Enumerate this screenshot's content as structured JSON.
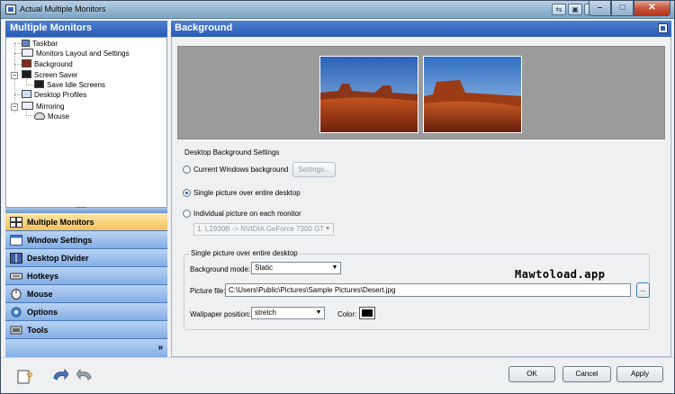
{
  "window": {
    "title": "Actual Multiple Monitors"
  },
  "left_panel": {
    "header": "Multiple Monitors",
    "tree": [
      {
        "label": "Taskbar"
      },
      {
        "label": "Monitors Layout and Settings"
      },
      {
        "label": "Background"
      },
      {
        "label": "Screen Saver"
      },
      {
        "label": "Save Idle Screens"
      },
      {
        "label": "Desktop Profiles"
      },
      {
        "label": "Mirroring"
      },
      {
        "label": "Mouse"
      }
    ],
    "nav": [
      {
        "label": "Multiple Monitors",
        "selected": true
      },
      {
        "label": "Window Settings"
      },
      {
        "label": "Desktop Divider"
      },
      {
        "label": "Hotkeys"
      },
      {
        "label": "Mouse"
      },
      {
        "label": "Options"
      },
      {
        "label": "Tools"
      }
    ]
  },
  "right_panel": {
    "header": "Background",
    "settings": {
      "group_title": "Desktop Background Settings",
      "option_current": "Current Windows background",
      "settings_button": "Settings...",
      "option_single": "Single picture over entire desktop",
      "option_individual": "Individual picture on each monitor",
      "monitor_select": "1. L1930B -> NVIDIA GeForce 7300 GT",
      "selected_option": "single"
    },
    "single_group": {
      "title": "Single picture over entire desktop",
      "mode_label": "Background mode:",
      "mode_value": "Static",
      "file_label": "Picture file:",
      "file_value": "C:\\Users\\Public\\Pictures\\Sample Pictures\\Desert.jpg",
      "browse_label": "...",
      "position_label": "Wallpaper position:",
      "position_value": "stretch",
      "color_label": "Color:",
      "color_value": "#000000"
    }
  },
  "watermark": "Mawtoload.app",
  "buttons": {
    "ok": "OK",
    "cancel": "Cancel",
    "apply": "Apply"
  },
  "colors": {
    "header_blue": "#2a5cb5",
    "nav_selected": "#f6c15a",
    "nav_blue": "#83aee6"
  }
}
